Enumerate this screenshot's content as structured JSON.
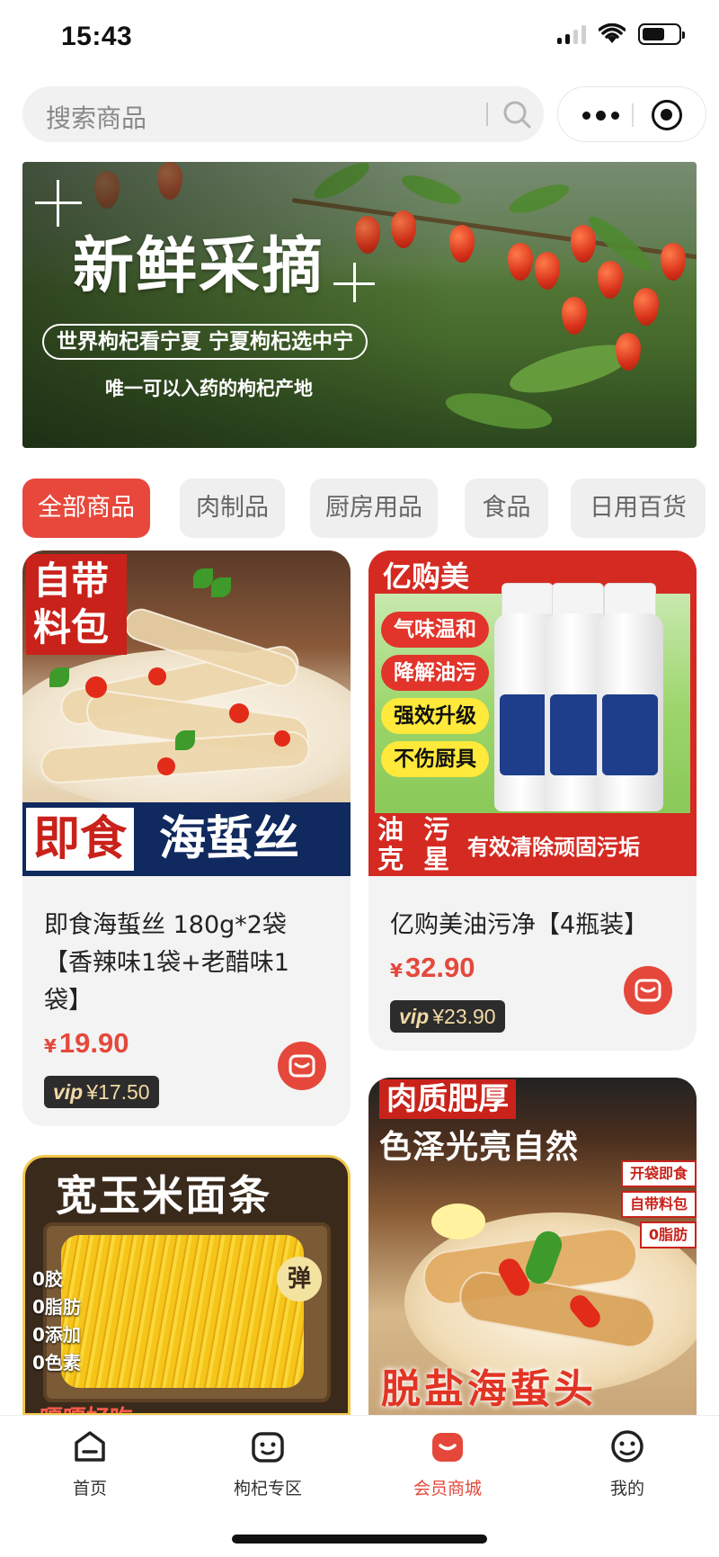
{
  "status_bar": {
    "time": "15:43"
  },
  "search": {
    "placeholder": "搜索商品"
  },
  "banner": {
    "title": "新鲜采摘",
    "slogan": "世界枸杞看宁夏 宁夏枸杞选中宁",
    "subtitle": "唯一可以入药的枸杞产地"
  },
  "categories": {
    "tabs": [
      "全部商品",
      "肉制品",
      "厨房用品",
      "食品",
      "日用百货"
    ],
    "active": 0
  },
  "products": [
    {
      "name_lines": [
        "即食海蜇丝 180g*2袋",
        "【香辣味1袋+老醋味1",
        "袋】"
      ],
      "currency": "¥",
      "price": "19.90",
      "vip_label": "vip",
      "vip_price": "¥17.50",
      "image_text": {
        "tag_line1": "自带",
        "tag_line2": "料包",
        "banner_left": "即食",
        "banner_right": "海蜇丝"
      }
    },
    {
      "name_lines": [
        "亿购美油污净【4瓶装】"
      ],
      "currency": "¥",
      "price": "32.90",
      "vip_label": "vip",
      "vip_price": "¥23.90",
      "image_text": {
        "brand": "亿购美",
        "pills": [
          "气味温和",
          "降解油污",
          "强效升级",
          "不伤厨具"
        ],
        "bottom_big_1": "油 污",
        "bottom_big_2": "克 星",
        "bottom_small": "有效清除顽固污垢"
      }
    },
    {
      "image_text": {
        "title": "宽玉米面条",
        "features": [
          "0胶",
          "0脂肪",
          "0添加",
          "0色素"
        ],
        "bubble": "弹",
        "strip": "嘎嘎好吃"
      }
    },
    {
      "image_text": {
        "title1": "肉质肥厚",
        "title2": "色泽光亮自然",
        "tags": [
          "开袋即食",
          "自带料包",
          "0脂肪"
        ],
        "bottom": "脱盐海蜇头"
      }
    }
  ],
  "tabbar": {
    "items": [
      "首页",
      "枸杞专区",
      "会员商城",
      "我的"
    ],
    "active": 2
  },
  "colors": {
    "accent": "#e5483b",
    "vip_bg": "#2c2c2c",
    "vip_text": "#f3d9a6"
  }
}
